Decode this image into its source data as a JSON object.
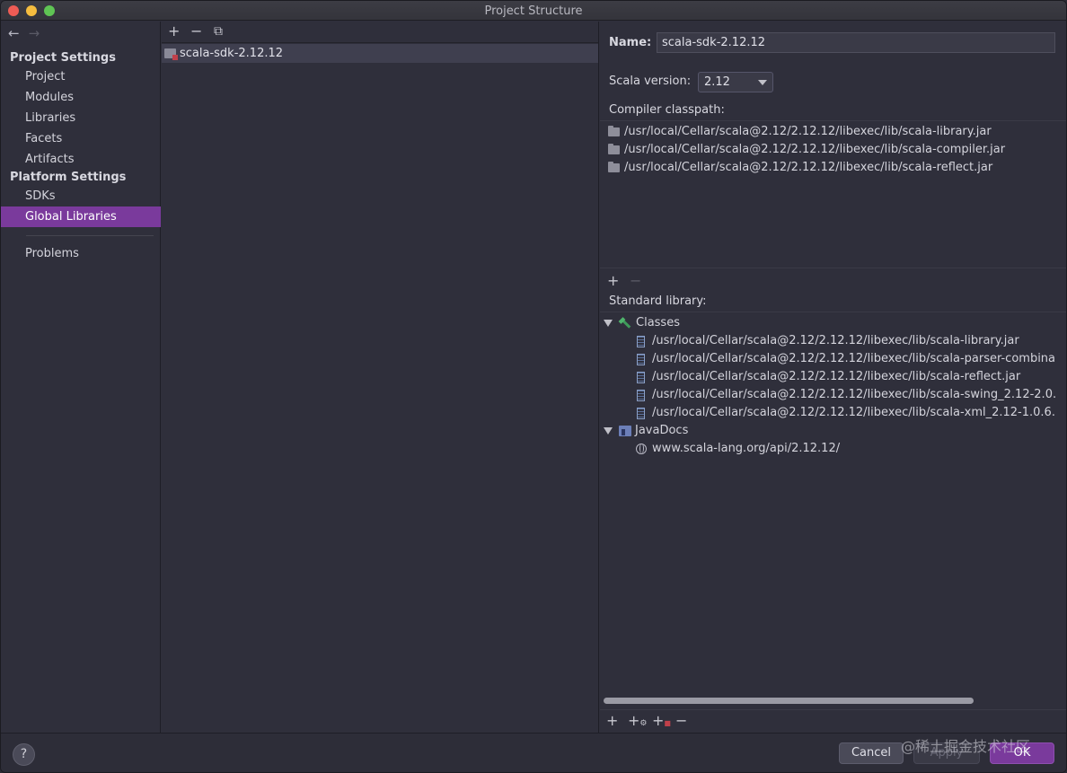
{
  "window": {
    "title": "Project Structure"
  },
  "sidebar": {
    "project_settings_header": "Project Settings",
    "project_items": [
      "Project",
      "Modules",
      "Libraries",
      "Facets",
      "Artifacts"
    ],
    "platform_settings_header": "Platform Settings",
    "platform_items": [
      "SDKs",
      "Global Libraries"
    ],
    "active_item": "Global Libraries",
    "problems": "Problems"
  },
  "middle": {
    "libraries": [
      {
        "label": "scala-sdk-2.12.12",
        "selected": true
      }
    ]
  },
  "details": {
    "name_label": "Name:",
    "name_value": "scala-sdk-2.12.12",
    "scala_version_label": "Scala version:",
    "scala_version_value": "2.12",
    "compiler_classpath_label": "Compiler classpath:",
    "compiler_classpath": [
      "/usr/local/Cellar/scala@2.12/2.12.12/libexec/lib/scala-library.jar",
      "/usr/local/Cellar/scala@2.12/2.12.12/libexec/lib/scala-compiler.jar",
      "/usr/local/Cellar/scala@2.12/2.12.12/libexec/lib/scala-reflect.jar"
    ],
    "standard_library_label": "Standard library:",
    "classes_label": "Classes",
    "classes": [
      "/usr/local/Cellar/scala@2.12/2.12.12/libexec/lib/scala-library.jar",
      "/usr/local/Cellar/scala@2.12/2.12.12/libexec/lib/scala-parser-combina",
      "/usr/local/Cellar/scala@2.12/2.12.12/libexec/lib/scala-reflect.jar",
      "/usr/local/Cellar/scala@2.12/2.12.12/libexec/lib/scala-swing_2.12-2.0.",
      "/usr/local/Cellar/scala@2.12/2.12.12/libexec/lib/scala-xml_2.12-1.0.6."
    ],
    "javadocs_label": "JavaDocs",
    "javadocs": [
      "www.scala-lang.org/api/2.12.12/"
    ]
  },
  "footer": {
    "help": "?",
    "cancel": "Cancel",
    "apply": "Apply",
    "ok": "OK",
    "watermark": "@稀土掘金技术社区"
  },
  "colors": {
    "accent": "#7a3a9c",
    "background": "#2f2f3b"
  }
}
